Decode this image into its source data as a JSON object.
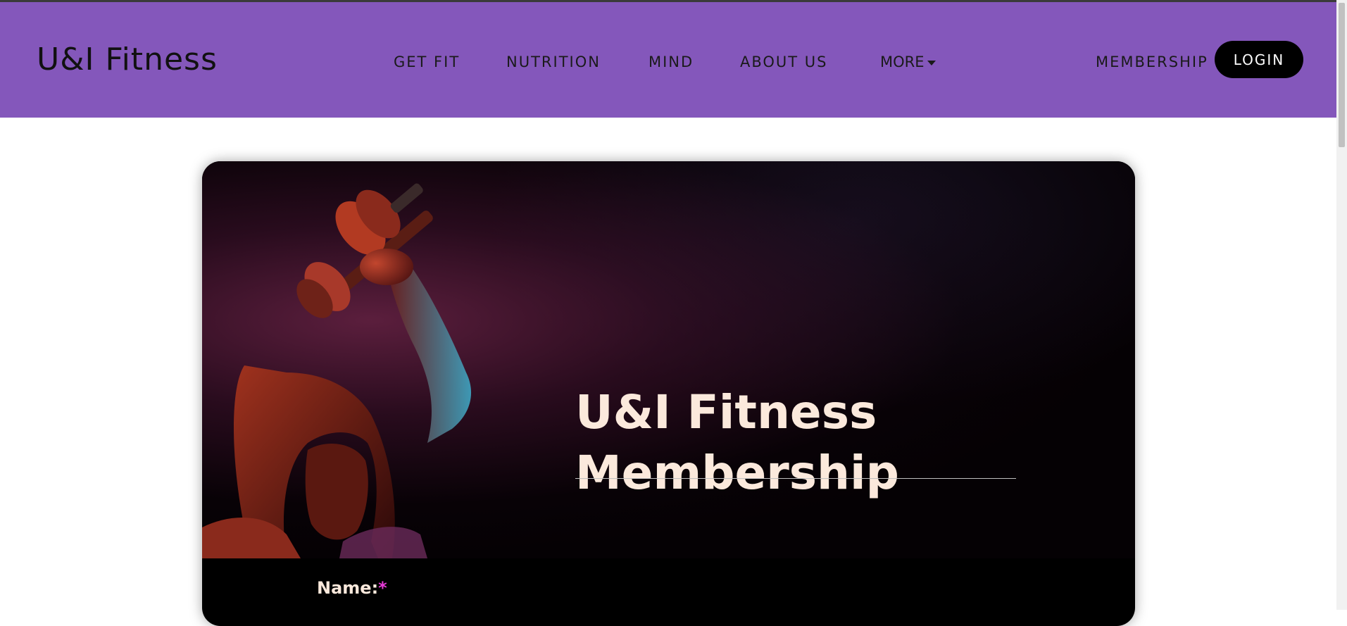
{
  "navbar": {
    "brand": "U&I Fitness",
    "links": [
      {
        "label": "GET FIT"
      },
      {
        "label": "NUTRITION"
      },
      {
        "label": "MIND"
      },
      {
        "label": "ABOUT US"
      },
      {
        "label": "MORE"
      },
      {
        "label": "MEMBERSHIP"
      }
    ],
    "login_label": "LOGIN",
    "background_color": "#8457bb"
  },
  "hero": {
    "title_line1": "U&I Fitness",
    "title_line2": "Membership"
  },
  "form": {
    "name_label": "Name:",
    "required_marker": "*"
  },
  "colors": {
    "accent": "#8457bb",
    "required": "#e83ad8",
    "title_text": "#fbe9dc"
  }
}
